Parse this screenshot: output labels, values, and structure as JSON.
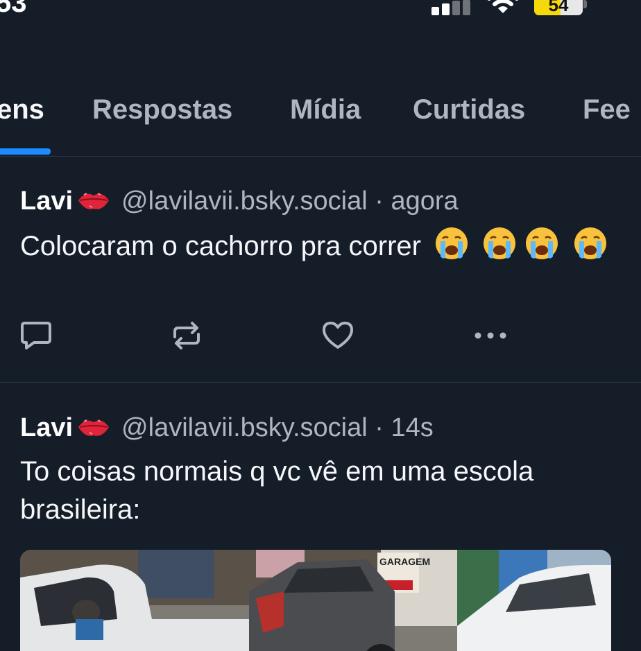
{
  "status_bar": {
    "time": "53",
    "battery": "54",
    "battery_fraction": 0.54
  },
  "tabs": [
    {
      "label": "ens",
      "active": true
    },
    {
      "label": "Respostas",
      "active": false
    },
    {
      "label": "Mídia",
      "active": false
    },
    {
      "label": "Curtidas",
      "active": false
    },
    {
      "label": "Fee",
      "active": false
    }
  ],
  "posts": [
    {
      "author": "Lavi",
      "author_icon": "lips-emoji",
      "handle": "@lavilavii.bsky.social",
      "separator": "·",
      "time": "agora",
      "text": "Colocaram o cachorro pra correr",
      "text_emoji": [
        "loudly-crying-face",
        "loudly-crying-face",
        "loudly-crying-face",
        "loudly-crying-face"
      ],
      "actions": [
        "reply-icon",
        "repost-icon",
        "like-icon",
        "more-icon"
      ]
    },
    {
      "author": "Lavi",
      "author_icon": "lips-emoji",
      "handle": "@lavilavii.bsky.social",
      "separator": "·",
      "time": "14s",
      "text": "To coisas normais q vc vê em uma escola brasileira:",
      "media_text": [
        "GARAGEM"
      ]
    }
  ],
  "colors": {
    "background": "#151d28",
    "accent": "#1d8cff",
    "muted_text": "#aeb6c0",
    "battery_fill": "#f5d90a"
  }
}
